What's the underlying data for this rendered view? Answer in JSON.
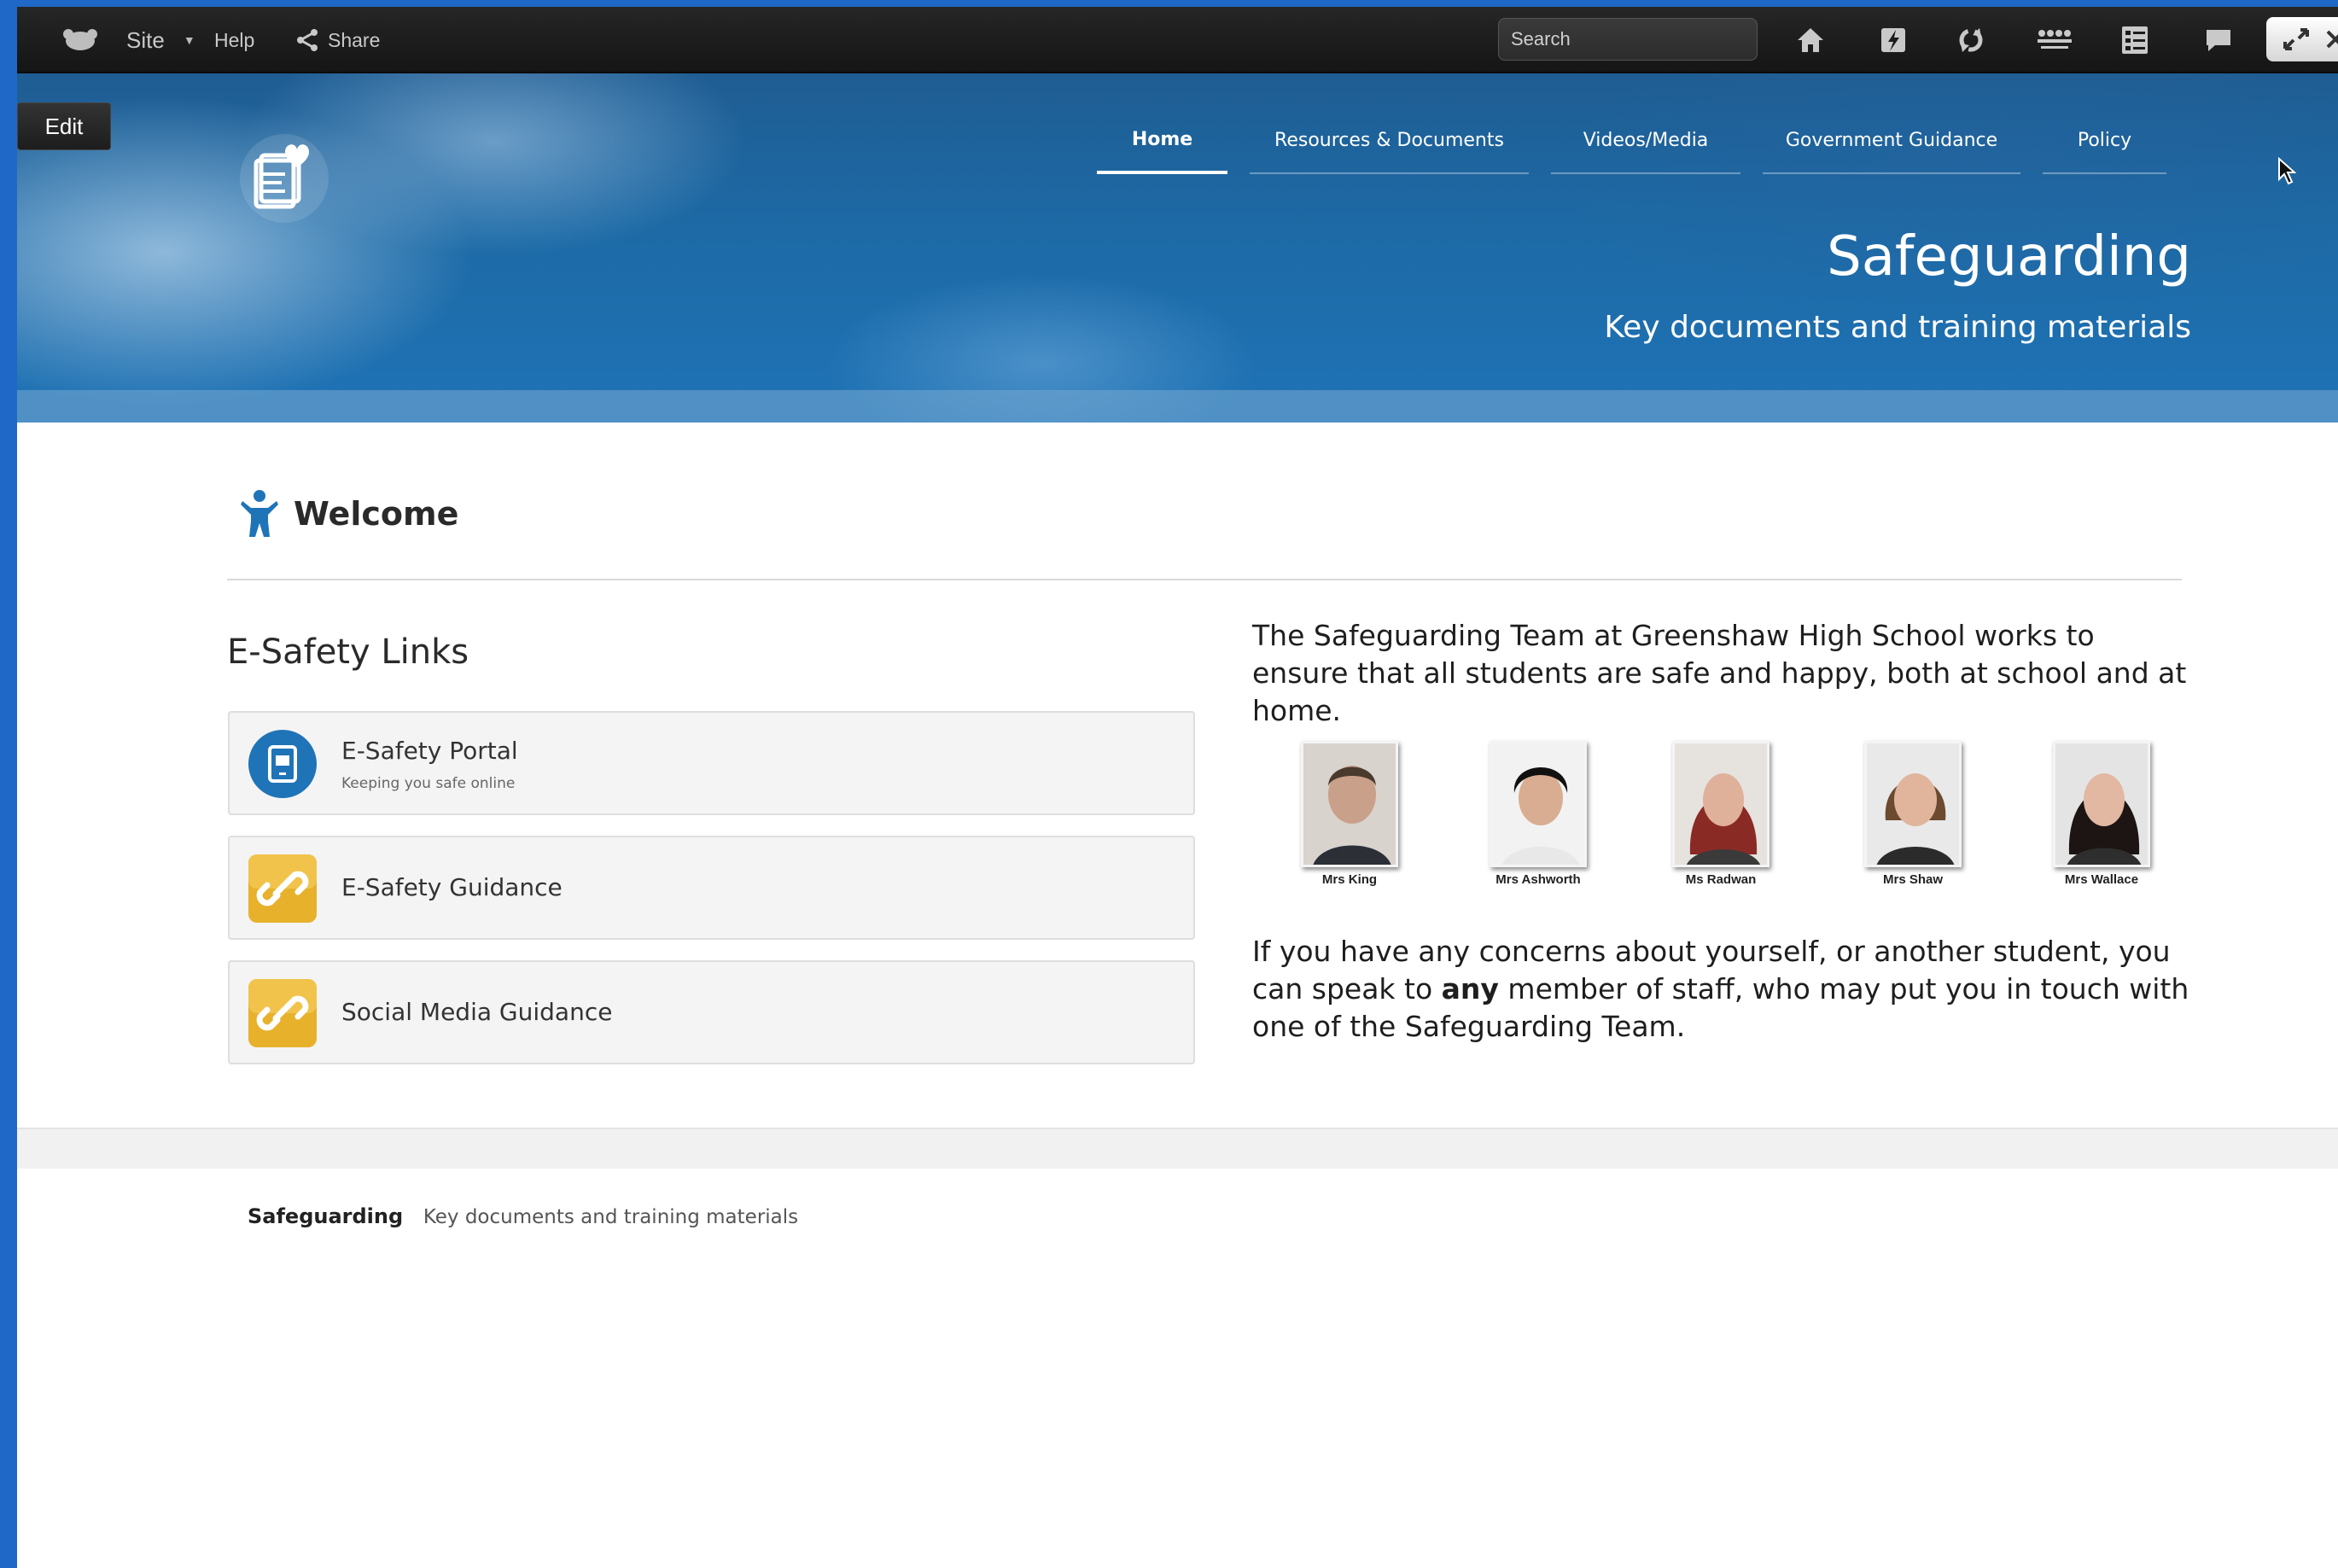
{
  "toolbar": {
    "site_label": "Site",
    "help_label": "Help",
    "share_label": "Share",
    "search_placeholder": "Search",
    "icons": [
      "home-icon",
      "lightning-icon",
      "sync-icon",
      "people-icon",
      "checklist-icon",
      "chat-icon",
      "expand-icon",
      "close-icon"
    ]
  },
  "banner": {
    "edit_label": "Edit",
    "nav": [
      {
        "label": "Home",
        "active": true
      },
      {
        "label": "Resources & Documents",
        "active": false
      },
      {
        "label": "Videos/Media",
        "active": false
      },
      {
        "label": "Government Guidance",
        "active": false
      },
      {
        "label": "Policy",
        "active": false
      }
    ],
    "title": "Safeguarding",
    "subtitle": "Key documents and training materials"
  },
  "welcome": {
    "title": "Welcome"
  },
  "links": {
    "heading": "E-Safety Links",
    "items": [
      {
        "label": "E-Safety Portal",
        "sub": "Keeping you safe online",
        "icon": "tablet-icon"
      },
      {
        "label": "E-Safety Guidance",
        "sub": "",
        "icon": "link-icon"
      },
      {
        "label": "Social Media Guidance",
        "sub": "",
        "icon": "link-icon"
      }
    ]
  },
  "intro": "The Safeguarding Team at Greenshaw High School works to ensure that all students are safe and happy, both at school and at home.",
  "staff": [
    {
      "name": "Mrs King"
    },
    {
      "name": "Mrs Ashworth"
    },
    {
      "name": "Ms Radwan"
    },
    {
      "name": "Mrs Shaw"
    },
    {
      "name": "Mrs Wallace"
    }
  ],
  "concern": {
    "before": "If you have any concerns about yourself, or another student, you can speak to ",
    "bold": "any",
    "after": " member of staff, who may put you in touch with one of the Safeguarding Team."
  },
  "footer": {
    "title": "Safeguarding",
    "subtitle": "Key documents and training materials"
  },
  "colors": {
    "banner": "#1f6aa6",
    "toolbar": "#1b1b1b",
    "accent_blue": "#1f74b8",
    "link_gold": "#e7b12c",
    "frame_blue": "#1f68c8"
  }
}
